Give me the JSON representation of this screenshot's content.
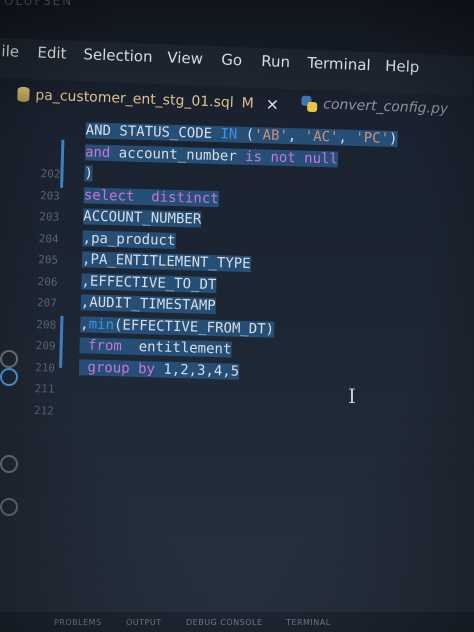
{
  "bezel": {
    "brand": "OLUFSEN"
  },
  "menu": [
    {
      "label": "ile"
    },
    {
      "label": "Edit"
    },
    {
      "label": "Selection"
    },
    {
      "label": "View"
    },
    {
      "label": "Go"
    },
    {
      "label": "Run"
    },
    {
      "label": "Terminal"
    },
    {
      "label": "Help"
    }
  ],
  "tabs": {
    "active": {
      "label": "pa_customer_ent_stg_01.sql",
      "modified": "M",
      "close": "×",
      "icon": "database-icon"
    },
    "inactive": {
      "label": "convert_config.py",
      "icon": "python-icon"
    }
  },
  "editor": {
    "lines": [
      {
        "num": "",
        "segments": [
          [
            "txt",
            "AND STATUS_CODE "
          ],
          [
            "kwb",
            "IN"
          ],
          [
            "txt",
            " ("
          ],
          [
            "str",
            "'AB'"
          ],
          [
            "txt",
            ", "
          ],
          [
            "str",
            "'AC'"
          ],
          [
            "txt",
            ", "
          ],
          [
            "str",
            "'PC'"
          ],
          [
            "txt",
            ")"
          ]
        ]
      },
      {
        "num": "",
        "segments": [
          [
            "kw",
            "and"
          ],
          [
            "txt",
            " account_number "
          ],
          [
            "kw",
            "is not null"
          ]
        ]
      },
      {
        "num": "202",
        "segments": [
          [
            "txt",
            ")"
          ]
        ]
      },
      {
        "num": "203",
        "segments": [
          [
            "kw",
            "select"
          ],
          [
            "txt",
            "  "
          ],
          [
            "kw",
            "distinct"
          ]
        ]
      },
      {
        "num": "203",
        "segments": [
          [
            "txt",
            "ACCOUNT_NUMBER"
          ]
        ]
      },
      {
        "num": "204",
        "segments": [
          [
            "txt",
            ",pa_product"
          ]
        ]
      },
      {
        "num": "205",
        "segments": [
          [
            "txt",
            ",PA_ENTITLEMENT_TYPE"
          ]
        ]
      },
      {
        "num": "206",
        "segments": [
          [
            "txt",
            ",EFFECTIVE_TO_DT"
          ]
        ]
      },
      {
        "num": "207",
        "segments": [
          [
            "txt",
            ",AUDIT_TIMESTAMP"
          ]
        ]
      },
      {
        "num": "208",
        "segments": [
          [
            "txt",
            ","
          ],
          [
            "kwb",
            "min"
          ],
          [
            "txt",
            "(EFFECTIVE_FROM_DT)"
          ]
        ]
      },
      {
        "num": "209",
        "segments": [
          [
            "txt",
            " "
          ],
          [
            "kw",
            "from"
          ],
          [
            "txt",
            "  entitlement"
          ]
        ]
      },
      {
        "num": "210",
        "segments": [
          [
            "txt",
            " "
          ],
          [
            "kw",
            "group by"
          ],
          [
            "txt",
            " 1,2,3,4,5"
          ]
        ]
      },
      {
        "num": "211",
        "segments": []
      },
      {
        "num": "212",
        "segments": []
      }
    ]
  },
  "panel": {
    "tabs": [
      {
        "label": "PROBLEMS"
      },
      {
        "label": "OUTPUT"
      },
      {
        "label": "DEBUG CONSOLE"
      },
      {
        "label": "TERMINAL"
      }
    ]
  },
  "colors": {
    "selection": "#264f78",
    "keyword": "#cc73d6",
    "builtin": "#3a94e6",
    "string": "#ce9178",
    "modified": "#e2c08d"
  }
}
